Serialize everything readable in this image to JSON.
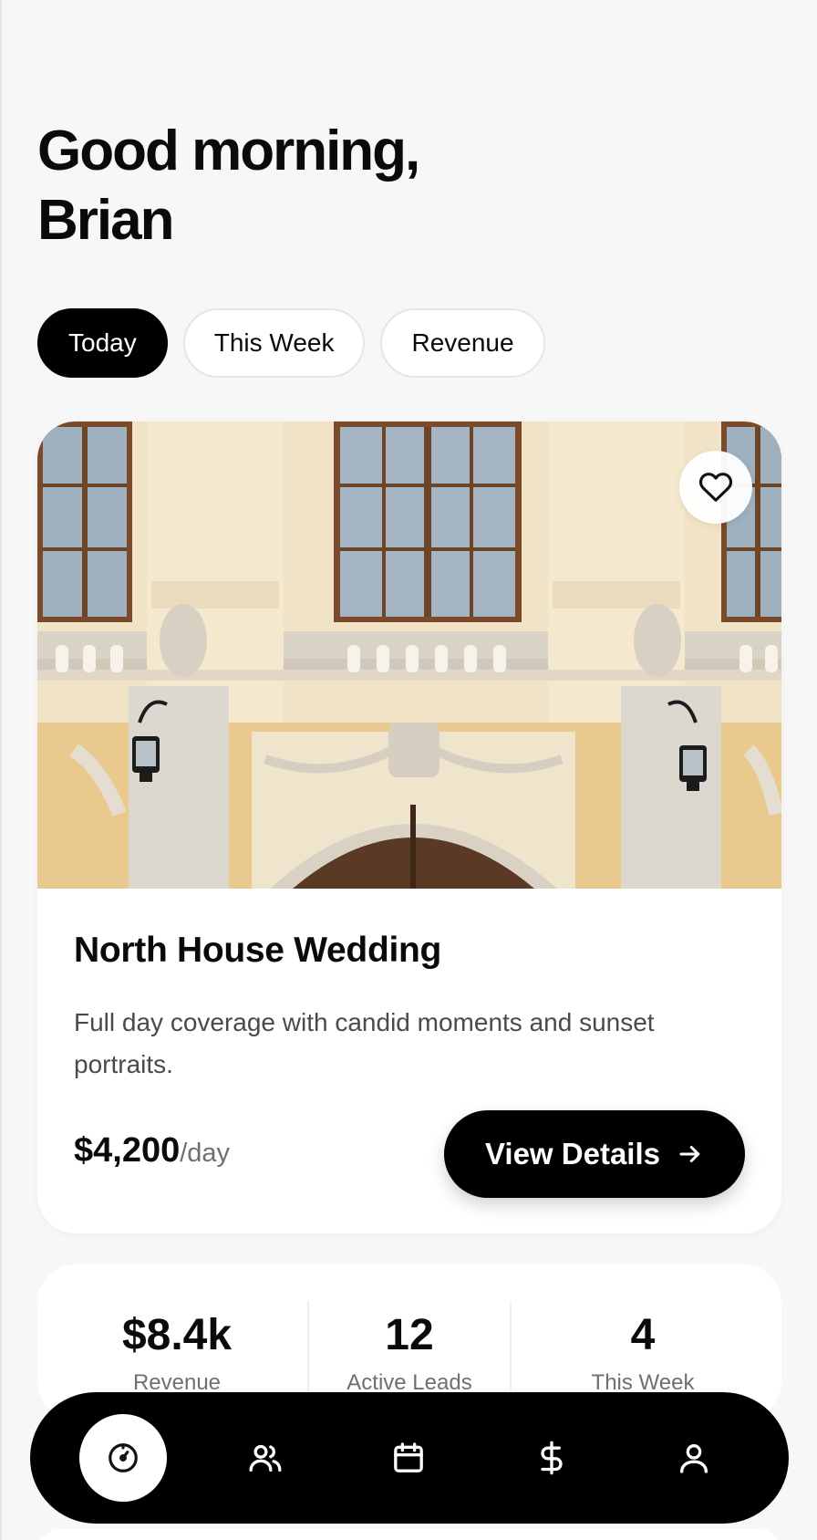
{
  "greeting": {
    "line1": "Good morning,",
    "line2": "Brian"
  },
  "filters": [
    {
      "label": "Today",
      "active": true
    },
    {
      "label": "This Week",
      "active": false
    },
    {
      "label": "Revenue",
      "active": false
    }
  ],
  "featured": {
    "image_icon": "photo-building-facade",
    "favorite_icon": "heart-icon",
    "title": "North House Wedding",
    "description": "Full day coverage with candid moments and sunset portraits.",
    "price": "$4,200",
    "price_unit": "/day",
    "cta_label": "View Details",
    "cta_icon": "arrow-right-icon"
  },
  "stats": [
    {
      "value": "$8.4k",
      "label": "Revenue"
    },
    {
      "value": "12",
      "label": "Active Leads"
    },
    {
      "value": "4",
      "label": "This Week"
    }
  ],
  "tabbar": {
    "items": [
      {
        "icon": "dashboard-gauge-icon",
        "active": true
      },
      {
        "icon": "users-icon",
        "active": false
      },
      {
        "icon": "calendar-icon",
        "active": false
      },
      {
        "icon": "dollar-icon",
        "active": false
      },
      {
        "icon": "profile-icon",
        "active": false
      }
    ]
  },
  "colors": {
    "background": "#f7f7f7",
    "accent": "#000000",
    "card": "#ffffff",
    "muted_text": "#6f6f6f"
  }
}
